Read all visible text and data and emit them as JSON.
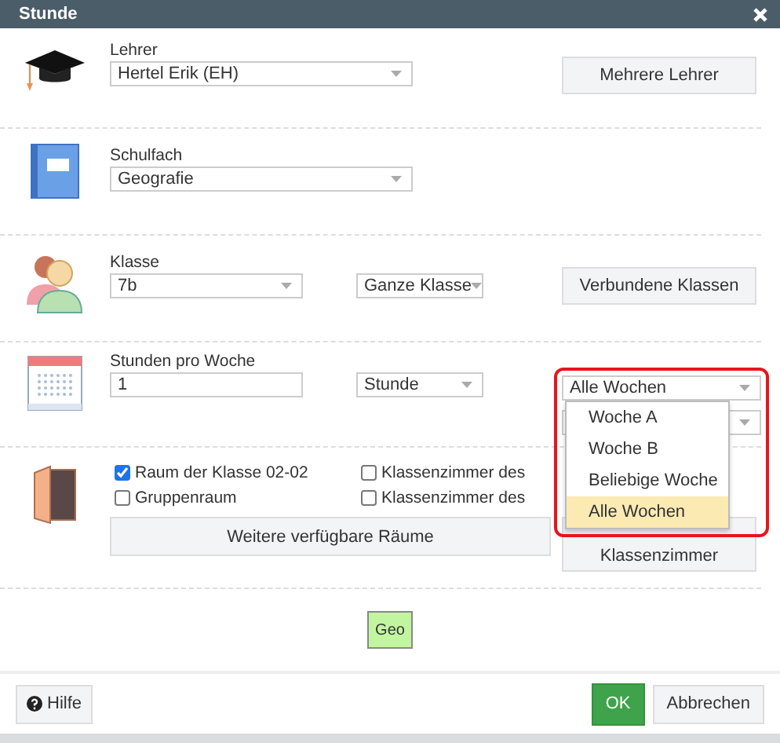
{
  "window": {
    "title": "Stunde"
  },
  "teacher": {
    "label": "Lehrer",
    "value": "Hertel Erik (EH)",
    "button": "Mehrere Lehrer"
  },
  "subject": {
    "label": "Schulfach",
    "value": "Geografie"
  },
  "class": {
    "label": "Klasse",
    "value": "7b",
    "group": "Ganze Klasse",
    "button": "Verbundene Klassen"
  },
  "hours": {
    "label": "Stunden pro Woche",
    "value": "1",
    "unit": "Stunde",
    "week": {
      "value": "Alle Wochen",
      "open": true,
      "highlighted": true,
      "options": [
        {
          "label": "Woche A",
          "selected": false
        },
        {
          "label": "Woche B",
          "selected": false
        },
        {
          "label": "Beliebige Woche",
          "selected": false
        },
        {
          "label": "Alle Wochen",
          "selected": true
        }
      ]
    }
  },
  "rooms": {
    "options": [
      {
        "label": "Raum der Klasse 02-02",
        "checked": true
      },
      {
        "label": "Klassenzimmer des",
        "checked": false
      },
      {
        "label": "Gruppenraum",
        "checked": false
      },
      {
        "label": "Klassenzimmer des",
        "checked": false
      }
    ],
    "button": "Weitere verfügbare Räume",
    "button_2": "Klassenzimmer"
  },
  "subject_tag": "Geo",
  "footer": {
    "help": "Hilfe",
    "ok": "OK",
    "cancel": "Abbrechen"
  }
}
